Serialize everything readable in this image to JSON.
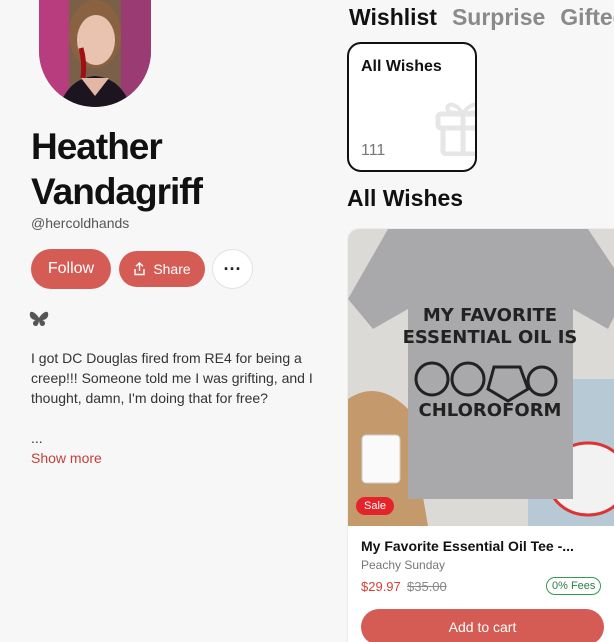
{
  "profile": {
    "name": "Heather Vandagriff",
    "handle": "@hercoldhands",
    "follow_label": "Follow",
    "share_label": "Share",
    "more_label": "···",
    "bio": "I got DC Douglas fired from RE4 for being a creep!!! Someone told me I was grifting, and I thought, damn, I'm doing that for free?",
    "bio_ellipsis": "...",
    "show_more_label": "Show more"
  },
  "tabs": [
    {
      "label": "Wishlist",
      "active": true
    },
    {
      "label": "Surprise",
      "active": false
    },
    {
      "label": "Gifted",
      "active": false
    }
  ],
  "wishlist_card": {
    "label": "All Wishes",
    "count": "111",
    "icon": "gift-icon"
  },
  "section_title": "All Wishes",
  "product": {
    "image_text": [
      "MY FAVORITE",
      "ESSENTIAL OIL IS",
      "CHLOROFORM"
    ],
    "sale_badge": "Sale",
    "title": "My Favorite Essential Oil Tee -...",
    "seller": "Peachy Sunday",
    "price_sale": "$29.97",
    "price_original": "$35.00",
    "fees_badge": "0% Fees",
    "add_to_cart_label": "Add to cart"
  },
  "colors": {
    "accent": "#d55b55",
    "sale_red": "#e4232a",
    "fees_green": "#2f9c52"
  }
}
